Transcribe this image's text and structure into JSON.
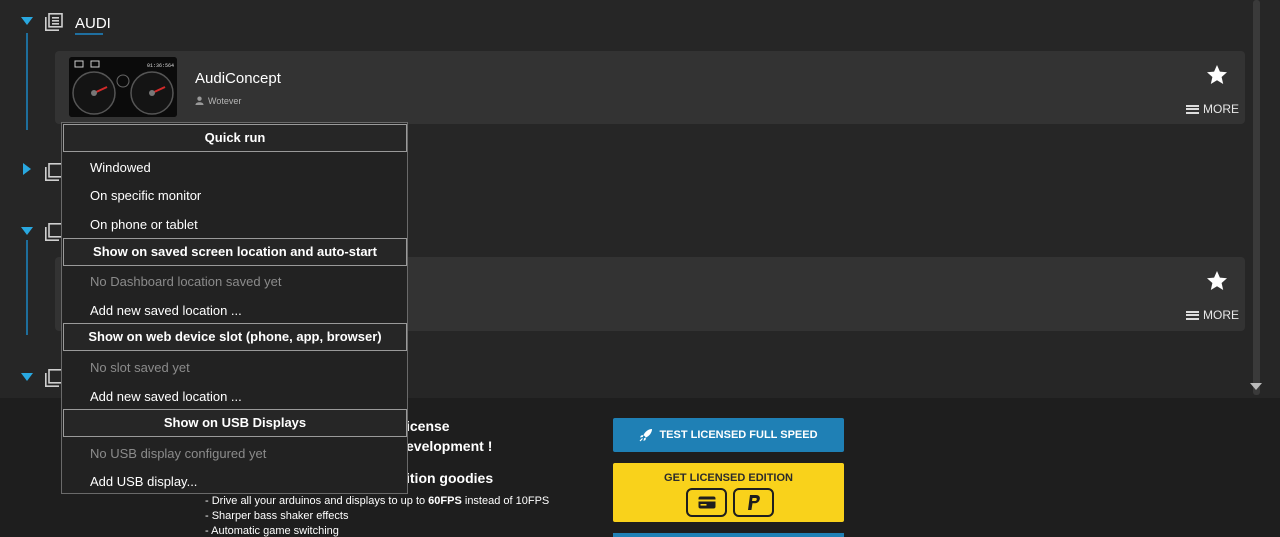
{
  "groups": [
    {
      "title": "AUDI",
      "expanded": true
    },
    {
      "title": "",
      "expanded": false
    },
    {
      "title": "",
      "expanded": true
    },
    {
      "title": "",
      "expanded": true
    }
  ],
  "cards": [
    {
      "title": "AudiConcept",
      "author": "Wotever",
      "more_label": "MORE"
    },
    {
      "title": "",
      "author": "",
      "more_label": "MORE"
    }
  ],
  "thumb": {
    "clock": "01:36:564"
  },
  "promo": {
    "line1": "icense",
    "line2": "evelopment !",
    "line3": "ition goodies",
    "bullets": [
      {
        "text_before": "- Drive all your arduinos and displays to up to ",
        "bold": "60FPS",
        "text_after": " instead of 10FPS"
      },
      {
        "text_before": "- Sharper bass shaker effects",
        "bold": "",
        "text_after": ""
      },
      {
        "text_before": "- Automatic game switching",
        "bold": "",
        "text_after": ""
      }
    ]
  },
  "buttons": {
    "test_label": "TEST LICENSED FULL SPEED",
    "get_label": "GET LICENSED EDITION"
  },
  "menu": {
    "quick_run_header": "Quick run",
    "windowed": "Windowed",
    "specific_monitor": "On specific monitor",
    "phone_tablet": "On phone or tablet",
    "saved_screen_header": "Show on saved screen location and auto-start",
    "no_location": "No Dashboard location saved yet",
    "add_location": "Add new saved location ...",
    "web_slot_header": "Show on web device slot (phone, app, browser)",
    "no_slot": "No slot saved yet",
    "add_slot_location": "Add new saved location ...",
    "usb_header": "Show on USB Displays",
    "no_usb": "No USB display configured yet",
    "add_usb": "Add USB display..."
  },
  "colors": {
    "accent": "#29a8e0",
    "button_blue": "#1f80b5",
    "button_yellow": "#f9d21b",
    "background": "#262626",
    "card": "#333333"
  }
}
